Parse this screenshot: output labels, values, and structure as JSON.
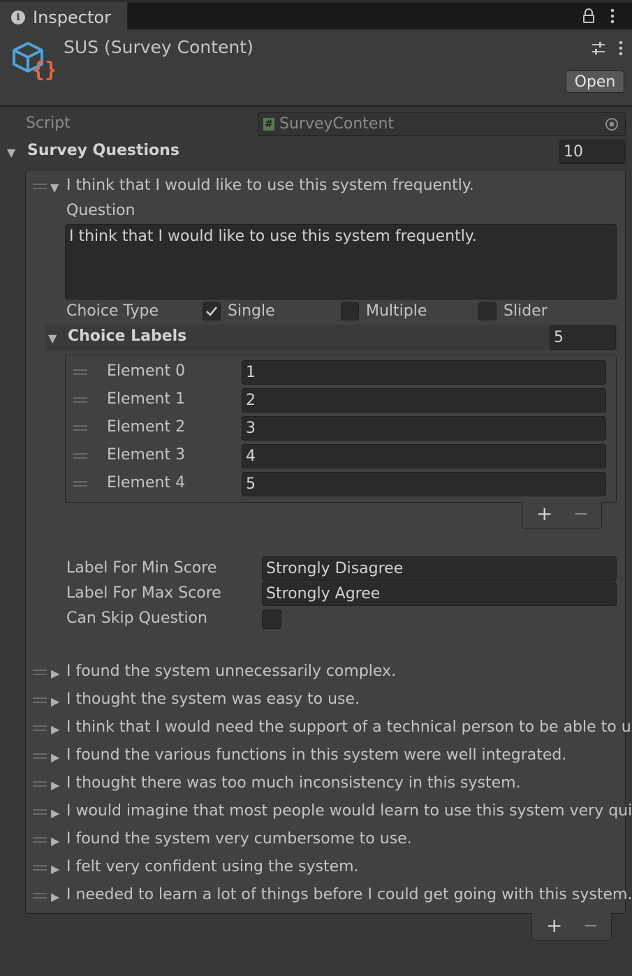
{
  "tab": {
    "title": "Inspector"
  },
  "header": {
    "title": "SUS (Survey Content)",
    "open_button": "Open"
  },
  "script_field": {
    "label": "Script",
    "value": "SurveyContent"
  },
  "survey_questions": {
    "label": "Survey Questions",
    "count": "10",
    "expanded_item": {
      "title": "I think that I would like to use this system frequently.",
      "question_label": "Question",
      "question_value": "I think that I would like to use this system frequently.",
      "choice_type_label": "Choice Type",
      "choice_types": [
        {
          "label": "Single",
          "checked": true
        },
        {
          "label": "Multiple",
          "checked": false
        },
        {
          "label": "Slider",
          "checked": false
        }
      ],
      "choice_labels": {
        "label": "Choice Labels",
        "count": "5",
        "elements": [
          {
            "label": "Element 0",
            "value": "1"
          },
          {
            "label": "Element 1",
            "value": "2"
          },
          {
            "label": "Element 2",
            "value": "3"
          },
          {
            "label": "Element 3",
            "value": "4"
          },
          {
            "label": "Element 4",
            "value": "5"
          }
        ]
      },
      "min_label": "Label For Min Score",
      "min_value": "Strongly Disagree",
      "max_label": "Label For Max Score",
      "max_value": "Strongly Agree",
      "skip_label": "Can Skip Question",
      "skip_checked": false
    },
    "collapsed_items": [
      "I found the system unnecessarily complex.",
      "I thought the system was easy to use.",
      "I think that I would need the support of a technical person to be able to use this system.",
      "I found the various functions in this system were well integrated.",
      "I thought there was too much inconsistency in this system.",
      "I would imagine that most people would learn to use this system very quickly.",
      "I found the system very cumbersome to use.",
      "I felt very confident using the system.",
      "I needed to learn a lot of things before I could get going with this system."
    ]
  },
  "list_buttons": {
    "add": "+",
    "remove": "−"
  },
  "colors": {
    "background": "#383838",
    "field": "#2a2a2a",
    "icon_blue": "#4fa3d9",
    "icon_orange": "#e8663d"
  }
}
